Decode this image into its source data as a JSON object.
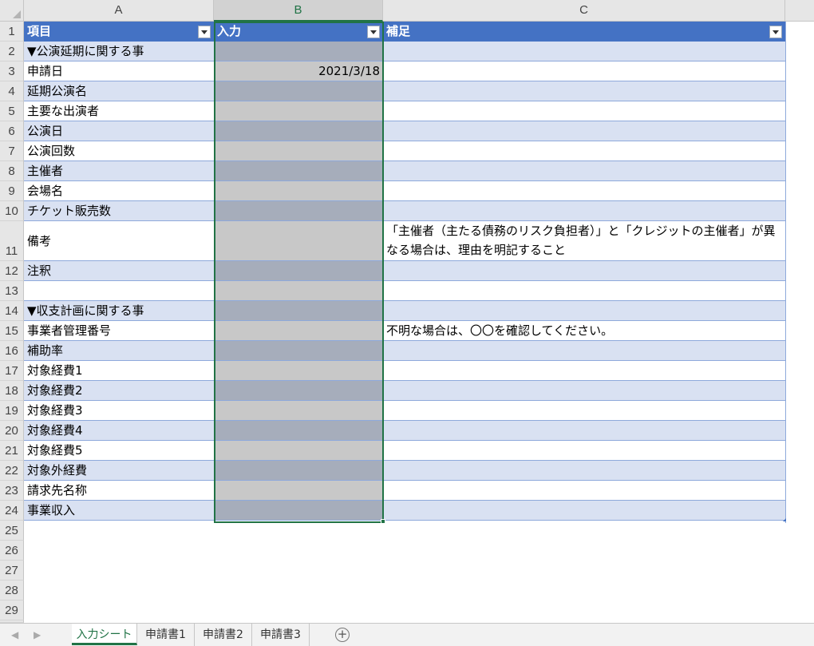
{
  "columns": [
    "A",
    "B",
    "C"
  ],
  "header": {
    "a": "項目",
    "b": "入力",
    "c": "補足"
  },
  "rows": [
    {
      "num": "2",
      "a": "▼公演延期に関する事",
      "b": "",
      "c": ""
    },
    {
      "num": "3",
      "a": "申請日",
      "b": "2021/3/18",
      "c": ""
    },
    {
      "num": "4",
      "a": "延期公演名",
      "b": "",
      "c": ""
    },
    {
      "num": "5",
      "a": "主要な出演者",
      "b": "",
      "c": ""
    },
    {
      "num": "6",
      "a": "公演日",
      "b": "",
      "c": ""
    },
    {
      "num": "7",
      "a": "公演回数",
      "b": "",
      "c": ""
    },
    {
      "num": "8",
      "a": "主催者",
      "b": "",
      "c": ""
    },
    {
      "num": "9",
      "a": "会場名",
      "b": "",
      "c": ""
    },
    {
      "num": "10",
      "a": "チケット販売数",
      "b": "",
      "c": ""
    },
    {
      "num": "11",
      "a": "備考",
      "b": "",
      "c": "「主催者（主たる債務のリスク負担者）」と「クレジットの主催者」が異なる場合は、理由を明記すること"
    },
    {
      "num": "12",
      "a": "注釈",
      "b": "",
      "c": ""
    },
    {
      "num": "13",
      "a": "",
      "b": "",
      "c": ""
    },
    {
      "num": "14",
      "a": "▼収支計画に関する事",
      "b": "",
      "c": ""
    },
    {
      "num": "15",
      "a": "事業者管理番号",
      "b": "",
      "c": "不明な場合は、〇〇を確認してください。"
    },
    {
      "num": "16",
      "a": "補助率",
      "b": "",
      "c": ""
    },
    {
      "num": "17",
      "a": "対象経費1",
      "b": "",
      "c": ""
    },
    {
      "num": "18",
      "a": "対象経費2",
      "b": "",
      "c": ""
    },
    {
      "num": "19",
      "a": "対象経費3",
      "b": "",
      "c": ""
    },
    {
      "num": "20",
      "a": "対象経費4",
      "b": "",
      "c": ""
    },
    {
      "num": "21",
      "a": "対象経費5",
      "b": "",
      "c": ""
    },
    {
      "num": "22",
      "a": "対象外経費",
      "b": "",
      "c": ""
    },
    {
      "num": "23",
      "a": "請求先名称",
      "b": "",
      "c": ""
    },
    {
      "num": "24",
      "a": "事業収入",
      "b": "",
      "c": ""
    }
  ],
  "empty_rows": [
    "25",
    "26",
    "27",
    "28",
    "29"
  ],
  "header_row_num": "1",
  "sheet_tabs": [
    "入力シート",
    "申請書1",
    "申請書2",
    "申請書3"
  ],
  "active_tab": "入力シート",
  "nav": {
    "prev": "◀",
    "next": "▶",
    "add": "+"
  },
  "colors": {
    "header_blue": "#4472c4",
    "band": "#d9e1f2",
    "input_gray": "#c8c8c8",
    "selection_green": "#217346"
  }
}
